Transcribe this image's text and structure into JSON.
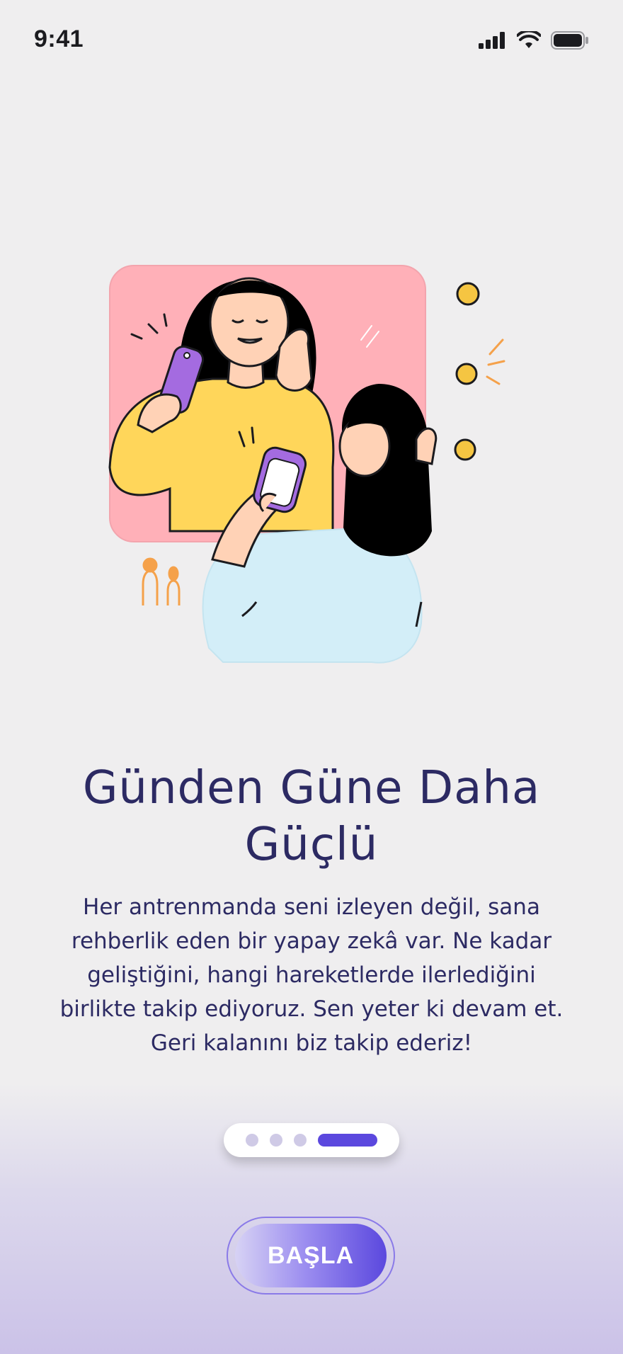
{
  "status_bar": {
    "time": "9:41",
    "icons": [
      "signal-icon",
      "wifi-icon",
      "battery-icon"
    ]
  },
  "onboarding": {
    "title": "Günden Güne Daha Güçlü",
    "description": "Her antrenmanda seni izleyen değil, sana rehberlik eden bir yapay zekâ var. Ne kadar geliştiğini, hangi hareketlerde ilerlediğini birlikte takip ediyoruz. Sen yeter ki devam et. Geri kalanını biz takip ederiz!",
    "illustration": "two-women-video-call-illustration",
    "pager": {
      "total": 4,
      "active_index": 3
    },
    "start_button": "BAŞLA"
  },
  "colors": {
    "title": "#2c2a63",
    "accent": "#5b48de",
    "inactive_dot": "#cfcae6",
    "card_pink": "#ffb0b8",
    "shirt_yellow": "#ffd65a",
    "shirt_blue": "#d3eef8",
    "phone_purple": "#a46be0",
    "coin_yellow": "#f5c542"
  }
}
